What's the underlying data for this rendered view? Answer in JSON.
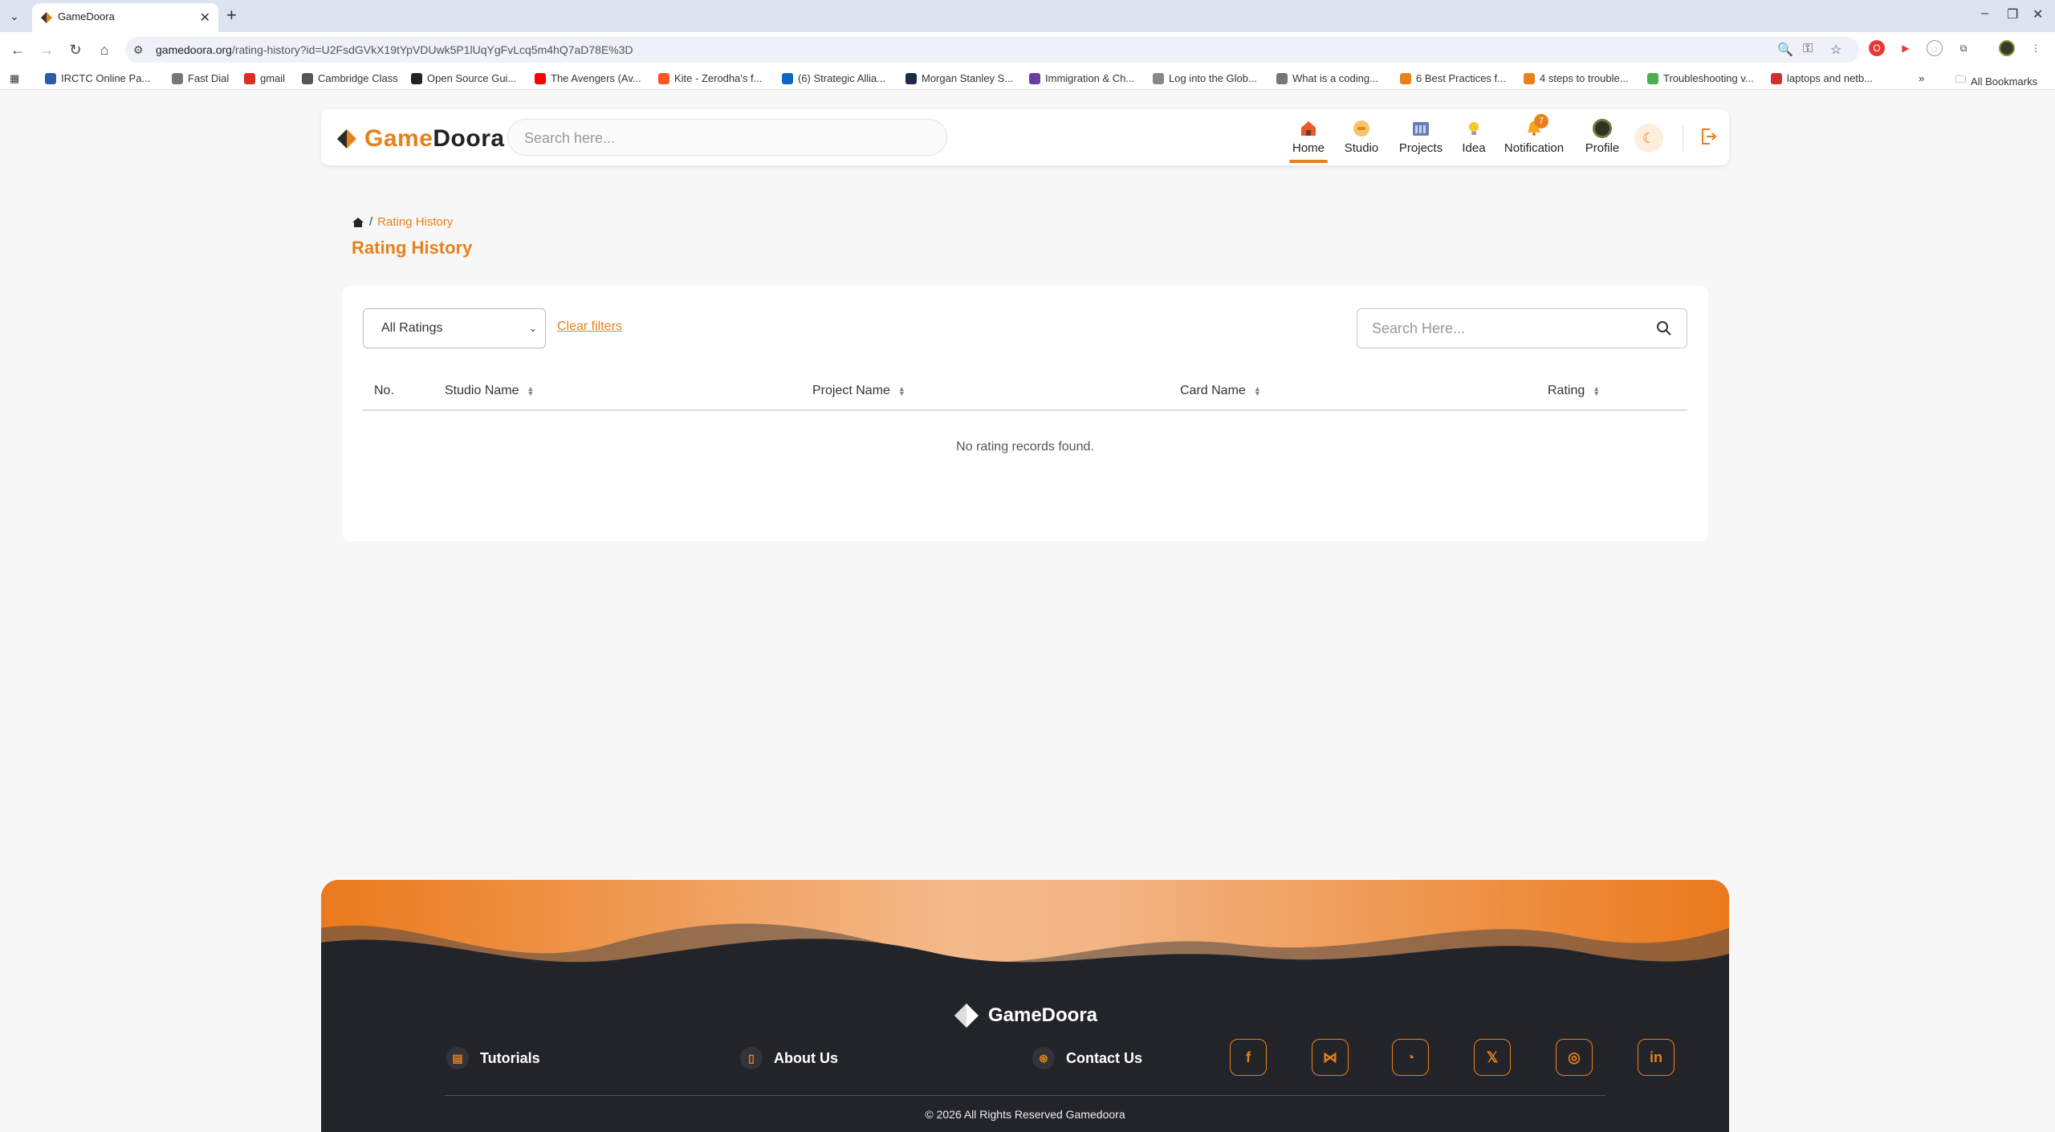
{
  "browser": {
    "tab_title": "GameDoora",
    "url_host": "gamedoora.org",
    "url_path": "/rating-history?id=U2FsdGVkX19tYpVDUwk5P1lUqYgFvLcq5m4hQ7aD78E%3D",
    "bookmarks": [
      {
        "label": "IRCTC Online Pa...",
        "color": "#2b5caa"
      },
      {
        "label": "Fast Dial",
        "color": "#777777"
      },
      {
        "label": "gmail",
        "color": "#d93025"
      },
      {
        "label": "Cambridge Class",
        "color": "#555555"
      },
      {
        "label": "Open Source Gui...",
        "color": "#222222"
      },
      {
        "label": "The Avengers (Av...",
        "color": "#ff0000"
      },
      {
        "label": "Kite - Zerodha's f...",
        "color": "#ff5722"
      },
      {
        "label": "(6) Strategic Allia...",
        "color": "#0a66c2"
      },
      {
        "label": "Morgan Stanley S...",
        "color": "#1c2b4a"
      },
      {
        "label": "Immigration & Ch...",
        "color": "#6b3fa0"
      },
      {
        "label": "Log into the Glob...",
        "color": "#888888"
      },
      {
        "label": "What is a coding...",
        "color": "#777777"
      },
      {
        "label": "6 Best Practices f...",
        "color": "#e8811a"
      },
      {
        "label": "4 steps to trouble...",
        "color": "#e8811a"
      },
      {
        "label": "Troubleshooting v...",
        "color": "#4caf50"
      },
      {
        "label": "laptops and netb...",
        "color": "#d32f2f"
      }
    ],
    "all_bookmarks": "All Bookmarks"
  },
  "header": {
    "logo": "GameDoora",
    "search_placeholder": "Search here...",
    "nav": [
      {
        "label": "Home",
        "icon": "home-icon"
      },
      {
        "label": "Studio",
        "icon": "studio-icon"
      },
      {
        "label": "Projects",
        "icon": "projects-icon"
      },
      {
        "label": "Idea",
        "icon": "idea-icon"
      },
      {
        "label": "Notification",
        "icon": "bell-icon"
      },
      {
        "label": "Profile",
        "icon": "avatar"
      }
    ],
    "notification_count": "7"
  },
  "breadcrumb": {
    "current": "Rating History"
  },
  "page_title": "Rating History",
  "filters": {
    "rating_select": "All Ratings",
    "clear_filters": "Clear filters",
    "search_placeholder": "Search Here..."
  },
  "table": {
    "columns": [
      "No.",
      "Studio Name",
      "Project Name",
      "Card Name",
      "Rating"
    ],
    "empty_message": "No rating records found."
  },
  "footer": {
    "logo": "GameDoora",
    "links": [
      "Tutorials",
      "About Us",
      "Contact Us"
    ],
    "social": [
      "facebook-icon",
      "bluesky-icon",
      "github-icon",
      "x-icon",
      "instagram-icon",
      "linkedin-icon"
    ],
    "copyright": "© 2026 All Rights Reserved Gamedoora"
  },
  "colors": {
    "accent": "#e8811a",
    "footer_bg": "#23242a"
  }
}
